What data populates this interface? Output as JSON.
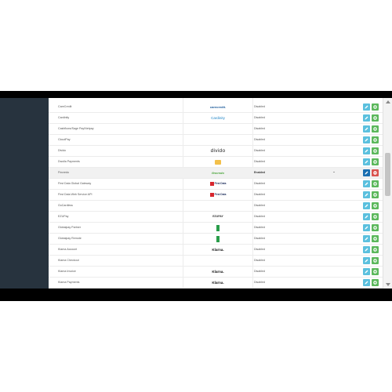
{
  "rows": [
    {
      "name": "CareCredit",
      "logo": {
        "type": "text",
        "icon": "carecredit-logo",
        "text": "carecredit."
      },
      "status": "Disabled",
      "enabled": false
    },
    {
      "name": "Cardinity",
      "logo": {
        "type": "text",
        "icon": "cardinity-logo",
        "text": "Cardinity"
      },
      "status": "Disabled",
      "enabled": false
    },
    {
      "name": "Cashflows/Sage Pay/Netpay",
      "logo": null,
      "status": "Disabled",
      "enabled": false
    },
    {
      "name": "CloudPay",
      "logo": null,
      "status": "Disabled",
      "enabled": false
    },
    {
      "name": "Divido",
      "logo": {
        "type": "text",
        "icon": "divido-logo",
        "text": "divido"
      },
      "status": "Disabled",
      "enabled": false
    },
    {
      "name": "Dwolla Payments",
      "logo": {
        "type": "graphic",
        "icon": "dwolla-logo"
      },
      "status": "Disabled",
      "enabled": false
    },
    {
      "name": "Fincredo",
      "logo": {
        "type": "text",
        "icon": "fincredo-logo",
        "text": "fincredo"
      },
      "status": "Enabled",
      "enabled": true
    },
    {
      "name": "First Data Global Gateway",
      "logo": {
        "type": "firstdata",
        "icon": "first-data-logo",
        "text": "First Data"
      },
      "status": "Disabled",
      "enabled": false
    },
    {
      "name": "First Data Web Service API",
      "logo": {
        "type": "firstdata",
        "icon": "first-data-logo",
        "text": "First Data"
      },
      "status": "Disabled",
      "enabled": false
    },
    {
      "name": "GoCardless",
      "logo": null,
      "status": "Disabled",
      "enabled": false
    },
    {
      "name": "EZUPay",
      "logo": {
        "type": "text",
        "icon": "ezupay-logo",
        "text": "EZUPAY"
      },
      "status": "Disabled",
      "enabled": false
    },
    {
      "name": "Globalpay Partner",
      "logo": {
        "type": "globalpay",
        "icon": "globalpay-logo"
      },
      "status": "Disabled",
      "enabled": false
    },
    {
      "name": "Globalpay Remote",
      "logo": {
        "type": "globalpay",
        "icon": "globalpay-logo"
      },
      "status": "Disabled",
      "enabled": false
    },
    {
      "name": "Klarna Account",
      "logo": {
        "type": "text",
        "icon": "klarna-logo",
        "text": "Klarna."
      },
      "status": "Disabled",
      "enabled": false
    },
    {
      "name": "Klarna Checkout",
      "logo": null,
      "status": "Disabled",
      "enabled": false
    },
    {
      "name": "Klarna Invoice",
      "logo": {
        "type": "text",
        "icon": "klarna-logo",
        "text": "Klarna."
      },
      "status": "Disabled",
      "enabled": false
    },
    {
      "name": "Klarna Payments",
      "logo": {
        "type": "text",
        "icon": "klarna-logo",
        "text": "Klarna."
      },
      "status": "Disabled",
      "enabled": false
    }
  ],
  "colors": {
    "sidebar": "#27333e",
    "edit_button": "#5bc0de",
    "edit_button_active": "#1b6fb1",
    "install_button": "#5cb85c",
    "uninstall_button": "#d9534f"
  },
  "icons": {
    "edit": "pencil-icon",
    "install": "plus-circle-icon",
    "uninstall": "minus-circle-icon"
  }
}
